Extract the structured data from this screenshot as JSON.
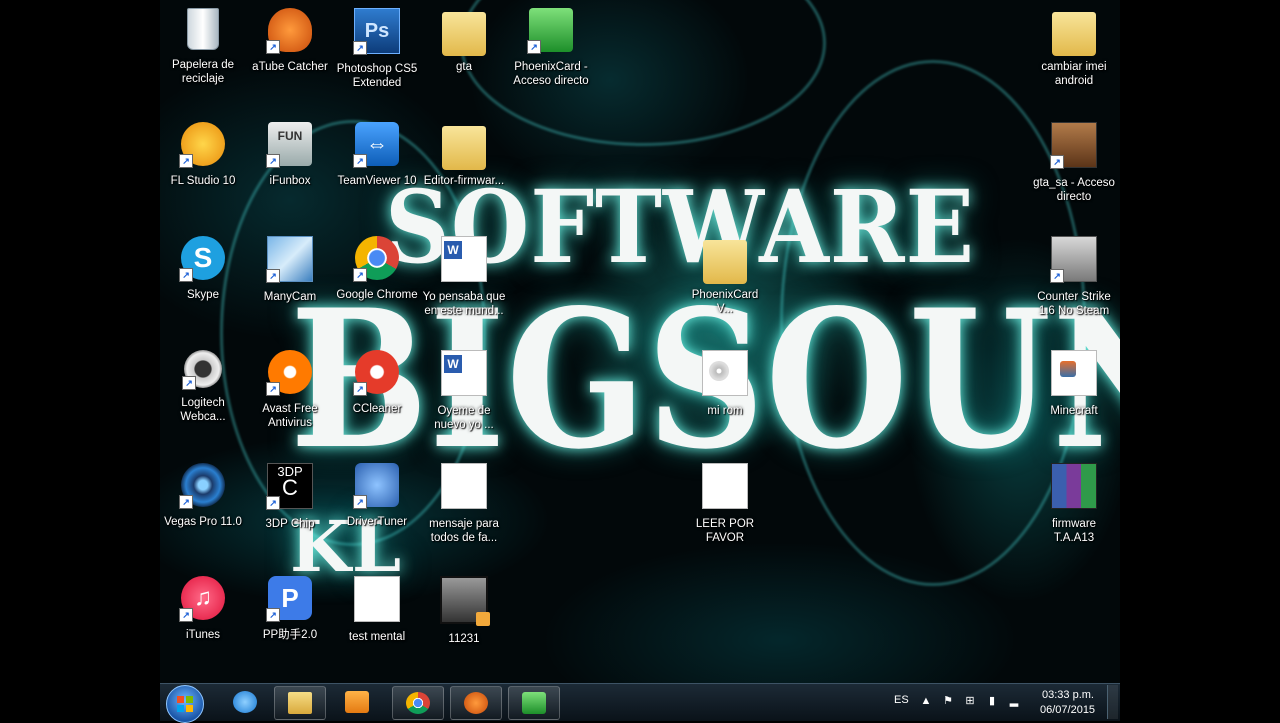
{
  "wallpaper": {
    "line1": "SOFTWARE",
    "line2": "BIGSOUND",
    "line3": "KL"
  },
  "desktop_icons": [
    {
      "label": "Papelera de reciclaje",
      "icon": "recycle-bin-icon"
    },
    {
      "label": "aTube Catcher",
      "icon": "atube-catcher-icon"
    },
    {
      "label": "Photoshop CS5 Extended",
      "icon": "photoshop-icon"
    },
    {
      "label": "gta",
      "icon": "folder-icon"
    },
    {
      "label": "PhoenixCard - Acceso directo",
      "icon": "phoenixcard-icon"
    },
    {
      "label": "cambiar imei android",
      "icon": "folder-icon"
    },
    {
      "label": "FL Studio 10",
      "icon": "fl-studio-icon"
    },
    {
      "label": "iFunbox",
      "icon": "ifunbox-icon"
    },
    {
      "label": "TeamViewer 10",
      "icon": "teamviewer-icon"
    },
    {
      "label": "Editor-firmwar...",
      "icon": "folder-icon"
    },
    {
      "label": "gta_sa - Acceso directo",
      "icon": "gta-sa-icon"
    },
    {
      "label": "Skype",
      "icon": "skype-icon"
    },
    {
      "label": "ManyCam",
      "icon": "manycam-icon"
    },
    {
      "label": "Google Chrome",
      "icon": "chrome-icon"
    },
    {
      "label": "Yo pensaba que en este mund...",
      "icon": "word-document-icon"
    },
    {
      "label": "PhoenixCard V...",
      "icon": "folder-icon"
    },
    {
      "label": "Counter Strike 1.6 No Steam",
      "icon": "counter-strike-icon"
    },
    {
      "label": "Logitech Webca...",
      "icon": "webcam-icon"
    },
    {
      "label": "Avast Free Antivirus",
      "icon": "avast-icon"
    },
    {
      "label": "CCleaner",
      "icon": "ccleaner-icon"
    },
    {
      "label": "Oyeme de nuevo yo ...",
      "icon": "word-document-icon"
    },
    {
      "label": "mi rom",
      "icon": "disc-image-icon"
    },
    {
      "label": "Minecraft",
      "icon": "java-file-icon"
    },
    {
      "label": "Vegas Pro 11.0",
      "icon": "vegas-pro-icon"
    },
    {
      "label": "3DP Chip",
      "icon": "3dp-chip-icon"
    },
    {
      "label": "DriverTuner",
      "icon": "drivertuner-icon"
    },
    {
      "label": "mensaje para todos de fa...",
      "icon": "text-file-icon"
    },
    {
      "label": "LEER POR FAVOR",
      "icon": "text-file-icon"
    },
    {
      "label": "firmware T.A.A13",
      "icon": "winrar-archive-icon"
    },
    {
      "label": "iTunes",
      "icon": "itunes-icon"
    },
    {
      "label": "PP助手2.0",
      "icon": "pp-assistant-icon"
    },
    {
      "label": "test mental",
      "icon": "text-file-icon"
    },
    {
      "label": "11231",
      "icon": "video-file-icon"
    }
  ],
  "dicon": {
    "papelera": "Papelera de reciclaje",
    "atube": "aTube Catcher",
    "photoshop": "Photoshop CS5 Extended",
    "gta": "gta",
    "phoenixcard": "PhoenixCard - Acceso directo",
    "cambiar": "cambiar imei android",
    "flstudio": "FL Studio 10",
    "ifunbox": "iFunbox",
    "teamviewer": "TeamViewer 10",
    "editor": "Editor-firmwar...",
    "gtasa": "gta_sa - Acceso directo",
    "skype": "Skype",
    "manycam": "ManyCam",
    "chrome": "Google Chrome",
    "yopensaba": "Yo pensaba que en este mund...",
    "phoenixv": "PhoenixCard V...",
    "cs": "Counter Strike 1.6 No Steam",
    "logitech": "Logitech Webca...",
    "avast": "Avast Free Antivirus",
    "ccleaner": "CCleaner",
    "oyeme": "Oyeme de nuevo yo ...",
    "mirom": "mi rom",
    "minecraft": "Minecraft",
    "vegas": "Vegas Pro 11.0",
    "chip": "3DP Chip",
    "drivertuner": "DriverTuner",
    "mensaje": "mensaje para todos de fa...",
    "leer": "LEER POR FAVOR",
    "firmware": "firmware T.A.A13",
    "itunes": "iTunes",
    "pp": "PP助手2.0",
    "test": "test mental",
    "video": "11231"
  },
  "taskbar": {
    "pinned": [
      "internet-explorer-icon",
      "file-explorer-icon",
      "media-player-icon",
      "chrome-icon",
      "atube-catcher-icon",
      "phoenixcard-icon"
    ],
    "language": "ES",
    "time": "03:33 p.m.",
    "date": "06/07/2015"
  }
}
